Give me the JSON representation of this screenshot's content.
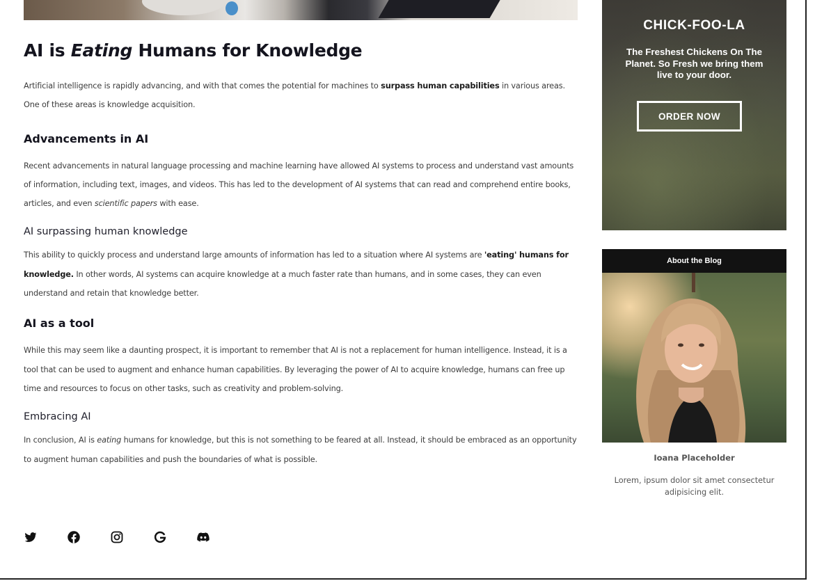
{
  "article": {
    "title_pre": "AI is ",
    "title_em": "Eating",
    "title_post": " Humans for Knowledge",
    "intro": {
      "t1": "Artificial intelligence is rapidly advancing, and with that comes the potential for machines to ",
      "b1": "surpass human capabilities",
      "t2": " in various areas. One of these areas is knowledge acquisition."
    },
    "section1": {
      "heading": "Advancements in AI",
      "t1": "Recent advancements in natural language processing and machine learning have allowed AI systems to process and understand vast amounts of information, including text, images, and videos. This has led to the development of AI systems that can read and comprehend entire books, articles, and even ",
      "i1": "scientific papers",
      "t2": " with ease."
    },
    "section2": {
      "heading": "AI surpassing human knowledge",
      "t1": "This ability to quickly process and understand large amounts of information has led to a situation where AI systems are ",
      "b1": "'eating' humans for knowledge.",
      "t2": " In other words, AI systems can acquire knowledge at a much faster rate than humans, and in some cases, they can even understand and retain that knowledge better."
    },
    "section3": {
      "heading": "AI as a tool",
      "t1": "While this may seem like a daunting prospect, it is important to remember that AI is not a replacement for human intelligence. Instead, it is a tool that can be used to augment and enhance human capabilities. By leveraging the power of AI to acquire knowledge, humans can free up time and resources to focus on other tasks, such as creativity and problem-solving."
    },
    "section4": {
      "heading": "Embracing AI",
      "t1": "In conclusion, AI is ",
      "i1": "eating",
      "t2": " humans for knowledge, but this is not something to be feared at all. Instead, it should be embraced as an opportunity to augment human capabilities and push the boundaries of what is possible."
    }
  },
  "social": {
    "icons": [
      "twitter-icon",
      "facebook-icon",
      "instagram-icon",
      "google-icon",
      "discord-icon"
    ]
  },
  "sidebar": {
    "ad": {
      "title": "CHICK-FOO-LA",
      "text": "The Freshest Chickens On The Planet. So Fresh we bring them live to your door.",
      "button": "ORDER NOW"
    },
    "about": {
      "header": "About the Blog",
      "name": "Ioana Placeholder",
      "description": "Lorem, ipsum dolor sit amet consectetur adipisicing elit."
    }
  },
  "colors": {
    "heading": "#14141e",
    "body_text": "#3c3c3c",
    "about_header_bg": "#121212"
  }
}
